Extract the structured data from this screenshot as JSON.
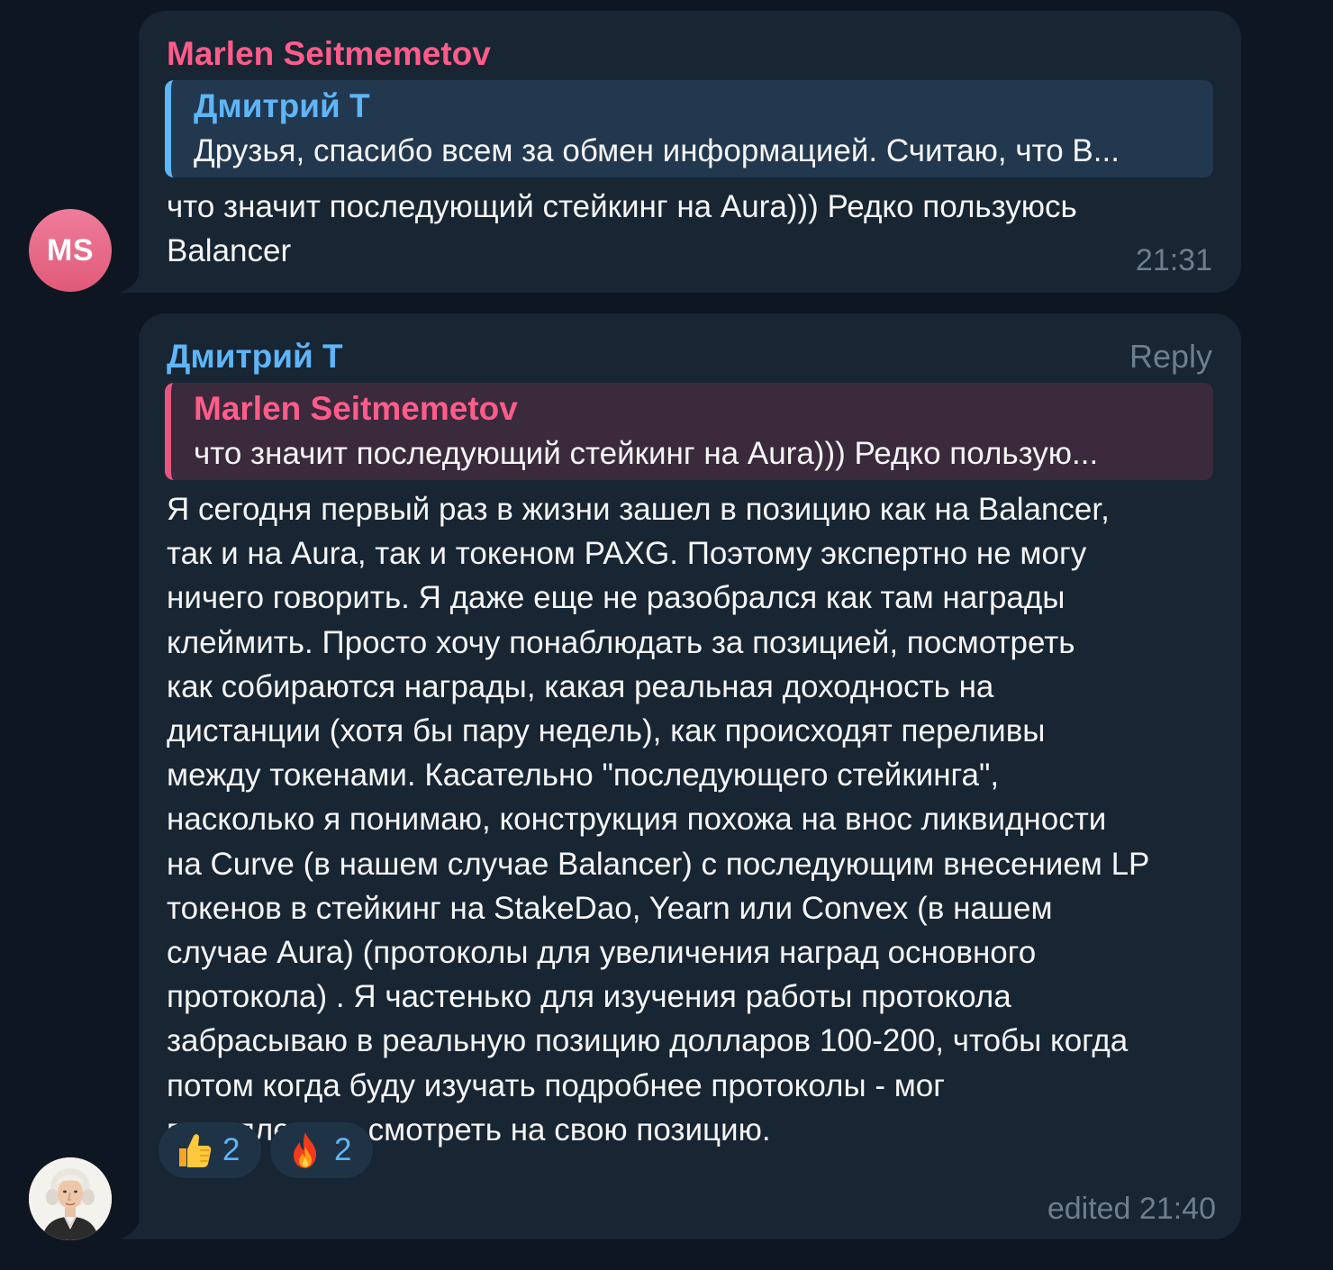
{
  "messages": [
    {
      "author": "Marlen Seitmemetov",
      "avatar_initials": "MS",
      "reply_to": {
        "author": "Дмитрий Т",
        "text": "Друзья, спасибо всем за обмен информацией. Считаю, что В..."
      },
      "text_lines": [
        "что значит последующий стейкинг на Aura))) Редко пользуюсь",
        "Balancer"
      ],
      "time": "21:31"
    },
    {
      "author": "Дмитрий Т",
      "reply_action": "Reply",
      "reply_to": {
        "author": "Marlen Seitmemetov",
        "text": "что значит последующий стейкинг на Aura))) Редко пользую..."
      },
      "text_lines": [
        "Я сегодня первый раз в жизни зашел в позицию как на Balancer,",
        "так и на Aura, так и токеном PAXG. Поэтому экспертно не могу",
        "ничего говорить. Я даже еще не разобрался как там награды",
        "клеймить. Просто хочу понаблюдать за позицией, посмотреть",
        "как собираются награды, какая реальная доходность на",
        "дистанции (хотя бы пару недель), как происходят переливы",
        "между токенами. Касательно \"последующего стейкинга\",",
        "насколько я понимаю, конструкция похожа на внос ликвидности",
        "на Curve (в нашем случае Balancer) с последующим внесением LP",
        "токенов в стейкинг на StakeDao, Yearn или Convex (в нашем",
        "случае Aura) (протоколы для увеличения наград основного",
        "протокола) . Я частенько для изучения работы протокола",
        "забрасываю в реальную позицию долларов 100-200, чтобы когда",
        "потом когда буду изучать подробнее протоколы - мог",
        "параллельно смотреть на свою позицию."
      ],
      "reactions": [
        {
          "icon": "thumbs-up-icon",
          "count": "2"
        },
        {
          "icon": "fire-icon",
          "count": "2"
        }
      ],
      "time": "edited 21:40"
    }
  ],
  "colors": {
    "background": "#0e1621",
    "bubble": "#182533",
    "author_pink": "#ff5c8a",
    "author_blue": "#5eb5f7",
    "meta_gray": "#6d7f8f"
  }
}
